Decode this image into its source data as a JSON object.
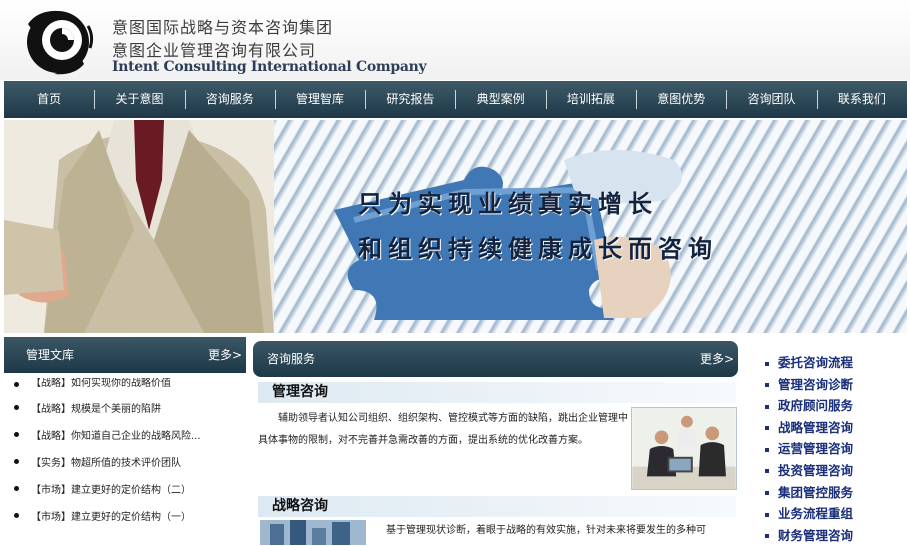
{
  "header": {
    "brand_line1": "意图国际战略与资本咨询集团",
    "brand_line2": "意图企业管理咨询有限公司",
    "brand_line3": "Intent Consulting International Company",
    "logo_icon": "swirl-logo"
  },
  "nav": {
    "items": [
      "首页",
      "关于意图",
      "咨询服务",
      "管理智库",
      "研究报告",
      "典型案例",
      "培训拓展",
      "意图优势",
      "咨询团队",
      "联系我们"
    ]
  },
  "banner": {
    "slogan_line1": "只为实现业绩真实增长",
    "slogan_line2": "和组织持续健康成长而咨询"
  },
  "library": {
    "title": "管理文库",
    "more": "更多>",
    "items": [
      "【战略】如何实现你的战略价值",
      "【战略】规模是个美丽的陷阱",
      "【战略】你知道自己企业的战略风险...",
      "【实务】物超所值的技术评价团队",
      "【市场】建立更好的定价结构（二）",
      "【市场】建立更好的定价结构（一）"
    ]
  },
  "services": {
    "title": "咨询服务",
    "more": "更多>",
    "section1_title": "管理咨询",
    "section1_text": "辅助领导者认知公司组织、组织架构、管控模式等方面的缺陷，跳出企业管理中具体事物的限制，对不完善并急需改善的方面，提出系统的优化改善方案。",
    "section2_title": "战略咨询",
    "section2_text": "基于管理现状诊断，着眼于战略的有效实施，针对未来将要发生的多种可"
  },
  "service_links": [
    "委托咨询流程",
    "管理咨询诊断",
    "政府顾问服务",
    "战略管理咨询",
    "运营管理咨询",
    "投资管理咨询",
    "集团管控服务",
    "业务流程重组",
    "财务管理咨询"
  ],
  "colors": {
    "nav_bg": "#2b4757",
    "link": "#1a2e7a",
    "section_bg": "#e4eef5"
  }
}
